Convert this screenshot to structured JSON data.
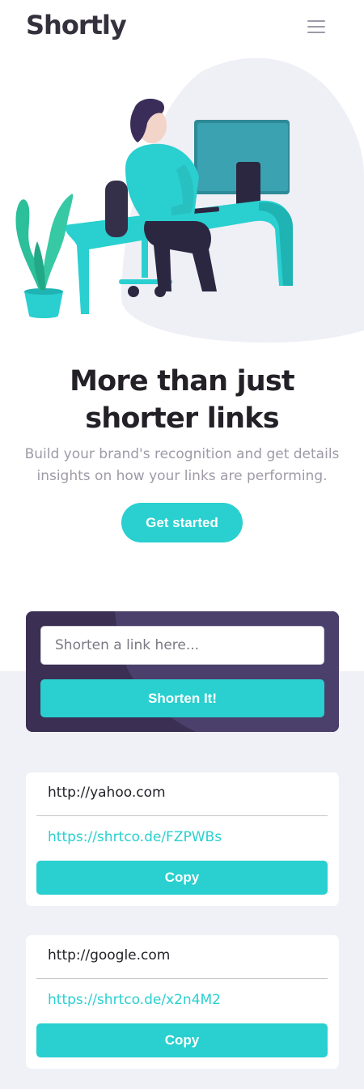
{
  "header": {
    "logo": "Shortly",
    "menu_icon": "hamburger-menu-icon"
  },
  "hero": {
    "illustration": "person-working-at-desk-illustration",
    "title": "More than just shorter links",
    "subtitle": "Build your brand's recognition and get details insights on how your links are performing.",
    "cta_label": "Get started"
  },
  "shorten": {
    "placeholder": "Shorten a link here...",
    "input_value": "",
    "button_label": "Shorten It!"
  },
  "results": [
    {
      "original": "http://yahoo.com",
      "short": "https://shrtco.de/FZPWBs",
      "copy_label": "Copy"
    },
    {
      "original": "http://google.com",
      "short": "https://shrtco.de/x2n4M2",
      "copy_label": "Copy"
    }
  ],
  "colors": {
    "primary_cyan": "#2acfcf",
    "dark_violet": "#3b3054",
    "grayish_violet": "#9e9aa7",
    "very_dark_violet": "#232127",
    "light_gray_bg": "#f0f1f6"
  }
}
